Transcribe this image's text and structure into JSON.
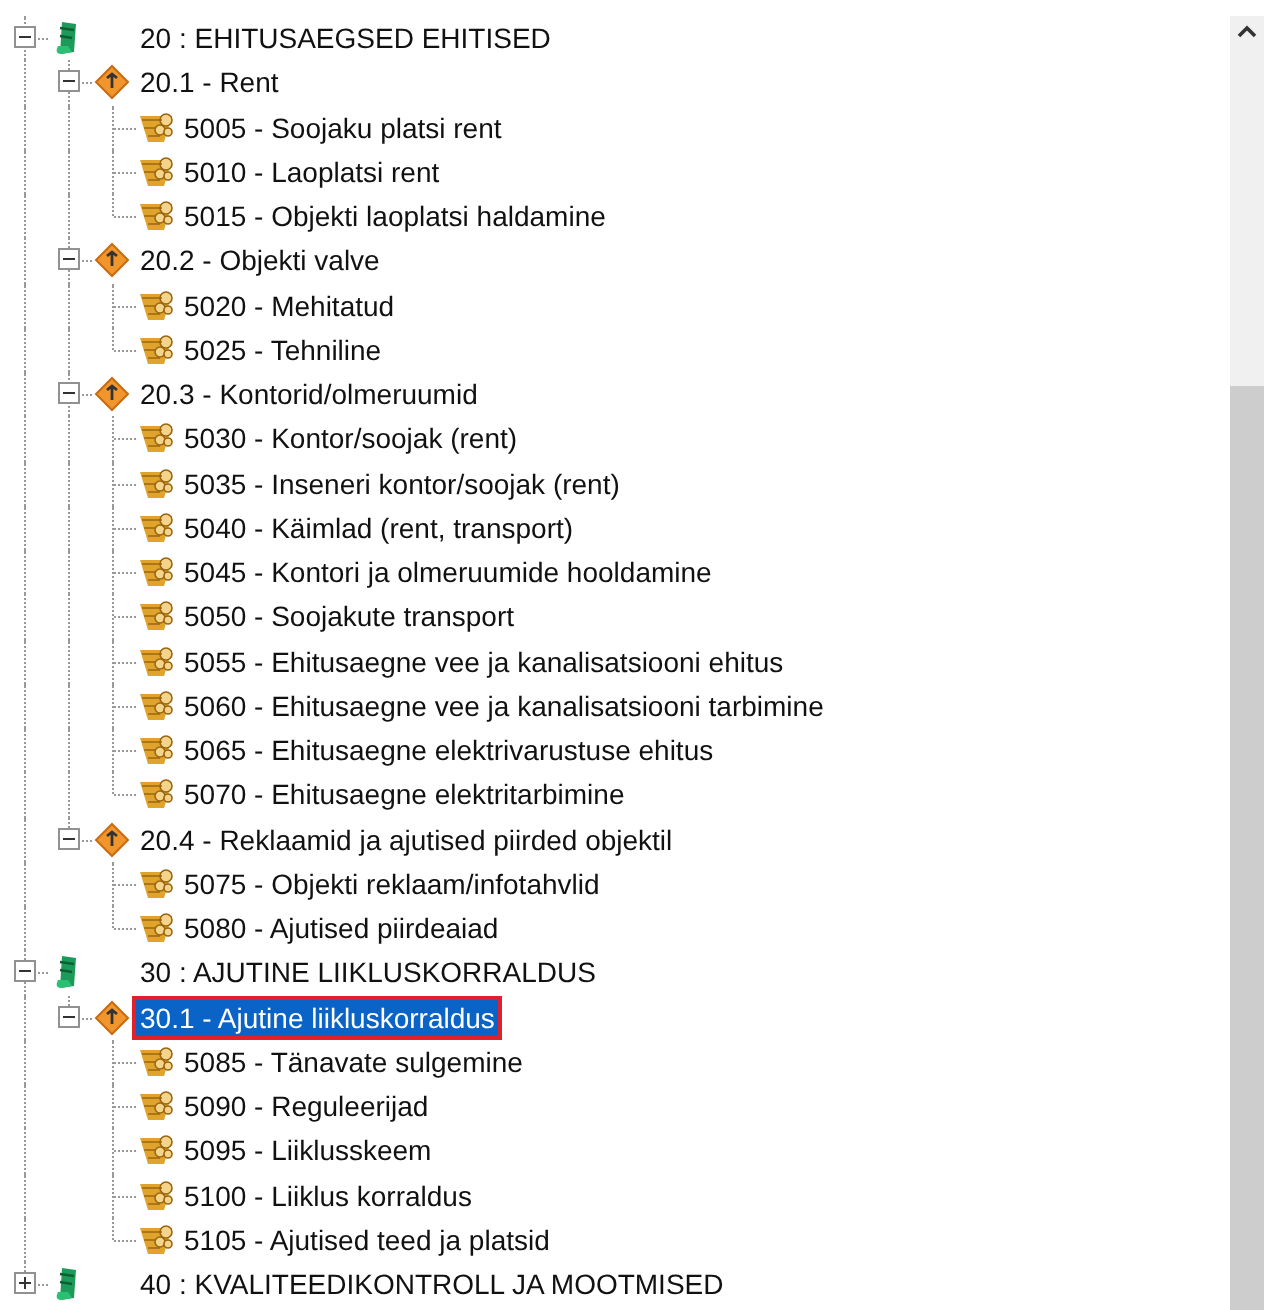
{
  "tree": [
    {
      "label": "20 : EHITUSAEGSED EHITISED",
      "kind": "group",
      "expanded": true,
      "selected": false,
      "children": [
        {
          "label": "20.1 - Rent",
          "kind": "section",
          "expanded": true,
          "selected": false,
          "children": [
            {
              "label": "5005 - Soojaku platsi rent",
              "kind": "item",
              "selected": false
            },
            {
              "label": "5010 - Laoplatsi rent",
              "kind": "item",
              "selected": false
            },
            {
              "label": "5015 - Objekti laoplatsi haldamine",
              "kind": "item",
              "selected": false
            }
          ]
        },
        {
          "label": "20.2 - Objekti valve",
          "kind": "section",
          "expanded": true,
          "selected": false,
          "children": [
            {
              "label": "5020 - Mehitatud",
              "kind": "item",
              "selected": false
            },
            {
              "label": "5025 - Tehniline",
              "kind": "item",
              "selected": false
            }
          ]
        },
        {
          "label": "20.3 - Kontorid/olmeruumid",
          "kind": "section",
          "expanded": true,
          "selected": false,
          "children": [
            {
              "label": "5030 - Kontor/soojak (rent)",
              "kind": "item",
              "selected": false
            },
            {
              "label": "5035 - Inseneri kontor/soojak (rent)",
              "kind": "item",
              "selected": false
            },
            {
              "label": "5040 - Käimlad (rent, transport)",
              "kind": "item",
              "selected": false
            },
            {
              "label": "5045 - Kontori ja olmeruumide hooldamine",
              "kind": "item",
              "selected": false
            },
            {
              "label": "5050 - Soojakute transport",
              "kind": "item",
              "selected": false
            },
            {
              "label": "5055 - Ehitusaegne vee ja kanalisatsiooni ehitus",
              "kind": "item",
              "selected": false
            },
            {
              "label": "5060 - Ehitusaegne vee ja kanalisatsiooni tarbimine",
              "kind": "item",
              "selected": false
            },
            {
              "label": "5065 - Ehitusaegne elektrivarustuse ehitus",
              "kind": "item",
              "selected": false
            },
            {
              "label": "5070 - Ehitusaegne elektritarbimine",
              "kind": "item",
              "selected": false
            }
          ]
        },
        {
          "label": "20.4 - Reklaamid ja ajutised piirded objektil",
          "kind": "section",
          "expanded": true,
          "selected": false,
          "children": [
            {
              "label": "5075 - Objekti reklaam/infotahvlid",
              "kind": "item",
              "selected": false
            },
            {
              "label": "5080 - Ajutised piirdeaiad",
              "kind": "item",
              "selected": false
            }
          ]
        }
      ]
    },
    {
      "label": "30 : AJUTINE LIIKLUSKORRALDUS",
      "kind": "group",
      "expanded": true,
      "selected": false,
      "children": [
        {
          "label": "30.1 - Ajutine liikluskorraldus",
          "kind": "section",
          "expanded": true,
          "selected": true,
          "children": [
            {
              "label": "5085 - Tänavate sulgemine",
              "kind": "item",
              "selected": false
            },
            {
              "label": "5090 - Reguleerijad",
              "kind": "item",
              "selected": false
            },
            {
              "label": "5095 - Liiklusskeem",
              "kind": "item",
              "selected": false
            },
            {
              "label": "5100 - Liiklus korraldus",
              "kind": "item",
              "selected": false
            },
            {
              "label": "5105 - Ajutised teed ja platsid",
              "kind": "item",
              "selected": false
            }
          ]
        }
      ]
    },
    {
      "label": "40 : KVALITEEDIKONTROLL JA MOOTMISED",
      "kind": "group",
      "expanded": false,
      "selected": false
    }
  ]
}
